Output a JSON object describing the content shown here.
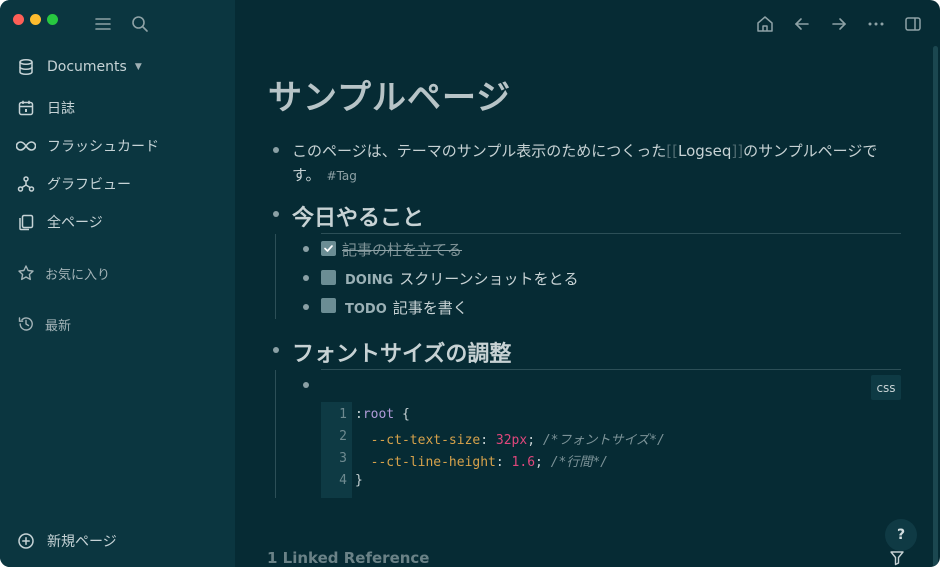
{
  "sidebar": {
    "documents_label": "Documents",
    "items": [
      {
        "label": "日誌",
        "icon": "calendar-icon"
      },
      {
        "label": "フラッシュカード",
        "icon": "infinity-icon"
      },
      {
        "label": "グラフビュー",
        "icon": "graph-icon"
      },
      {
        "label": "全ページ",
        "icon": "pages-icon"
      }
    ],
    "favorites_label": "お気に入り",
    "recent_label": "最新",
    "new_page_label": "新規ページ"
  },
  "page": {
    "title": "サンプルページ",
    "intro_before": "このページは、テーマのサンプル表示のためにつくった",
    "link_open": "[[",
    "link_text": "Logseq",
    "link_close": "]]",
    "intro_after": "のサンプルページで",
    "intro_line2": "す。",
    "tag": "#Tag",
    "section1": {
      "heading": "今日やること",
      "tasks": [
        {
          "marker": "",
          "text": "記事の柱を立てる",
          "done": true
        },
        {
          "marker": "DOING",
          "text": "スクリーンショットをとる",
          "done": false
        },
        {
          "marker": "TODO",
          "text": "記事を書く",
          "done": false
        }
      ]
    },
    "section2": {
      "heading": "フォントサイズの調整",
      "code_lang": "css",
      "code": {
        "line_numbers": [
          "1",
          "2",
          "3",
          "4"
        ],
        "l1_sel": ":",
        "l1_kw": "root",
        "l1_brace": " {",
        "l2_prop": "  --ct-text-size",
        "l2_colon": ": ",
        "l2_val": "32px",
        "l2_semi": "; ",
        "l2_comment": "/*フォントサイズ*/",
        "l3_prop": "  --ct-line-height",
        "l3_colon": ": ",
        "l3_val": "1.6",
        "l3_semi": "; ",
        "l3_comment": "/*行間*/",
        "l4": "}"
      }
    },
    "linked_reference": "1 Linked Reference"
  },
  "help_label": "?",
  "colors": {
    "background": "#062b34",
    "sidebar": "#0b3640",
    "text": "#c7d2d4",
    "keyword": "#b19cd9",
    "property": "#d6a24b",
    "number": "#e0477c"
  }
}
